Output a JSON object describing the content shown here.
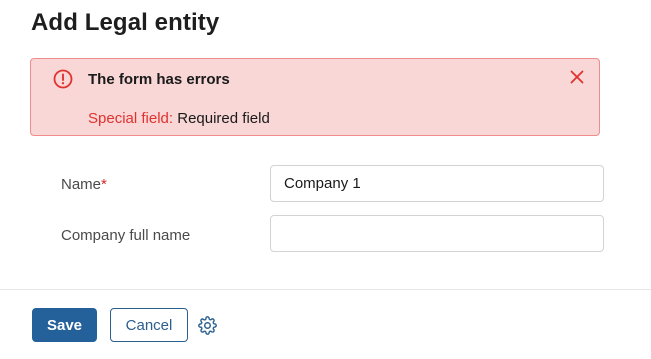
{
  "page": {
    "title": "Add Legal entity"
  },
  "error": {
    "icon": "alert-circle-icon",
    "title": "The form has errors",
    "field_name": "Special field:",
    "message": "Required field",
    "close_icon": "close-icon",
    "colors": {
      "background": "#f8d7d6",
      "border": "#ee8d8b",
      "accent": "#e0322f"
    }
  },
  "form": {
    "fields": [
      {
        "label": "Name",
        "required_mark": "*",
        "value": "Company 1",
        "placeholder": ""
      },
      {
        "label": "Company full name",
        "value": "",
        "placeholder": ""
      }
    ]
  },
  "footer": {
    "save_label": "Save",
    "cancel_label": "Cancel",
    "settings_icon": "gear-icon",
    "colors": {
      "primary": "#24619a"
    }
  }
}
